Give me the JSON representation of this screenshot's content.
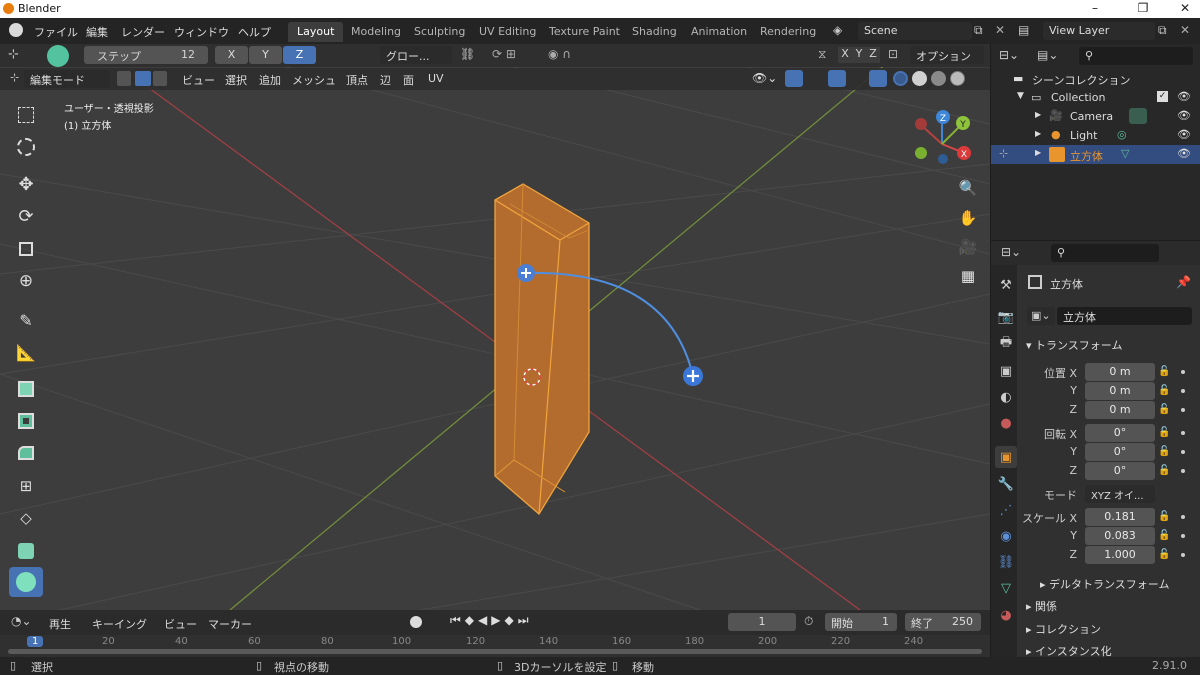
{
  "app": {
    "title": "Blender",
    "version": "2.91.0"
  },
  "menus": [
    "ファイル",
    "編集",
    "レンダー",
    "ウィンドウ",
    "ヘルプ"
  ],
  "workspaces": [
    "Layout",
    "Modeling",
    "Sculpting",
    "UV Editing",
    "Texture Paint",
    "Shading",
    "Animation",
    "Rendering"
  ],
  "active_workspace": "Layout",
  "scene": {
    "name": "Scene",
    "view_layer": "View Layer"
  },
  "tool_header": {
    "step_label": "ステップ",
    "step_value": "12",
    "axes": [
      "X",
      "Y",
      "Z"
    ],
    "active_axis": "Z",
    "orientation": "グロー...",
    "options": "オプション",
    "xyz": [
      "X",
      "Y",
      "Z"
    ]
  },
  "viewport_header": {
    "mode": "編集モード",
    "menus": [
      "ビュー",
      "選択",
      "追加",
      "メッシュ",
      "頂点",
      "辺",
      "面",
      "UV"
    ]
  },
  "viewport": {
    "projection": "ユーザー・透視投影",
    "object_label": "(1) 立方体",
    "gizmo": {
      "x": "X",
      "y": "Y",
      "z": "Z"
    }
  },
  "timeline": {
    "menus": [
      "再生",
      "キーイング",
      "ビュー",
      "マーカー"
    ],
    "current_frame": "1",
    "start_label": "開始",
    "start": "1",
    "end_label": "終了",
    "end": "250",
    "ticks": [
      "1",
      "20",
      "40",
      "60",
      "80",
      "100",
      "120",
      "140",
      "160",
      "180",
      "200",
      "220",
      "240"
    ]
  },
  "status": {
    "select": "選択",
    "view_move": "視点の移動",
    "cursor": "3Dカーソルを設定",
    "move": "移動"
  },
  "outliner": {
    "scene_collection": "シーンコレクション",
    "collection": "Collection",
    "items": [
      "Camera",
      "Light",
      "立方体"
    ],
    "selected": "立方体"
  },
  "properties": {
    "object_name": "立方体",
    "object_field": "立方体",
    "transform_title": "トランスフォーム",
    "location_label": "位置 X",
    "location": [
      "0 m",
      "0 m",
      "0 m"
    ],
    "rotation_label": "回転 X",
    "rotation": [
      "0°",
      "0°",
      "0°"
    ],
    "mode_label": "モード",
    "mode_value": "XYZ オイ...",
    "scale_label": "スケール X",
    "scale": [
      "0.181",
      "0.083",
      "1.000"
    ],
    "axis_y": "Y",
    "axis_z": "Z",
    "delta": "デルタトランスフォーム",
    "sections": [
      "関係",
      "コレクション",
      "インスタンス化"
    ]
  },
  "colors": {
    "accent": "#4772b3",
    "selection": "#e8952e",
    "x_axis": "#dc3a3a",
    "y_axis": "#8ec43b",
    "z_axis": "#3d86d8",
    "header_bg": "#2f2f2f",
    "viewport_bg": "#3d3d3d"
  }
}
